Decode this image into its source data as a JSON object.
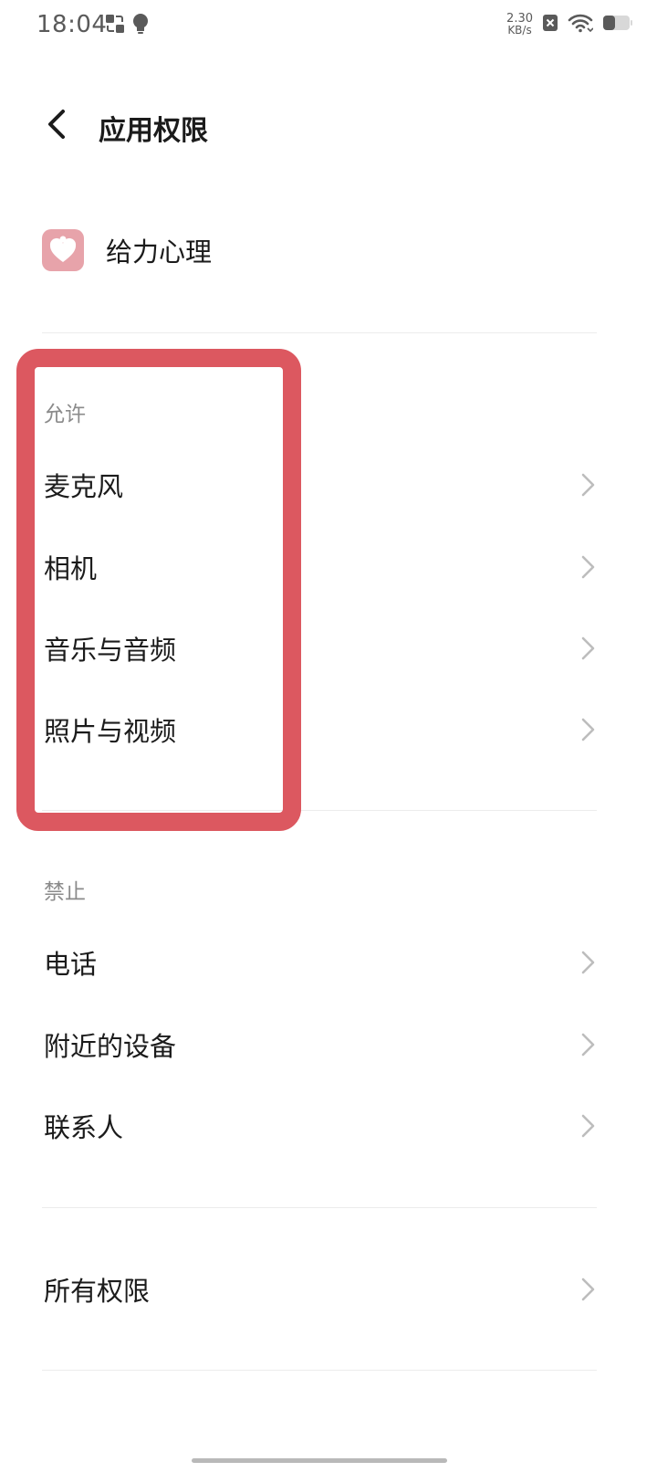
{
  "status_bar": {
    "time": "18:04",
    "net_speed_value": "2.30",
    "net_speed_unit": "KB/s",
    "icons": [
      "screen-cast-icon",
      "bulb-icon",
      "sim-off-icon",
      "wifi-icon",
      "battery-icon"
    ]
  },
  "header": {
    "title": "应用权限",
    "back_icon": "chevron-left-icon"
  },
  "app": {
    "name": "给力心理",
    "icon": "heart-app-icon",
    "icon_color": "#e7a3aa"
  },
  "allowed": {
    "label": "允许",
    "items": [
      {
        "label": "麦克风"
      },
      {
        "label": "相机"
      },
      {
        "label": "音乐与音频"
      },
      {
        "label": "照片与视频"
      }
    ]
  },
  "denied": {
    "label": "禁止",
    "items": [
      {
        "label": "电话"
      },
      {
        "label": "附近的设备"
      },
      {
        "label": "联系人"
      }
    ]
  },
  "all_permissions": {
    "label": "所有权限"
  },
  "colors": {
    "highlight": "#dc5860",
    "text_primary": "#1b1b1b",
    "text_secondary": "#8b8b8b",
    "chevron": "#bdbdbd"
  }
}
